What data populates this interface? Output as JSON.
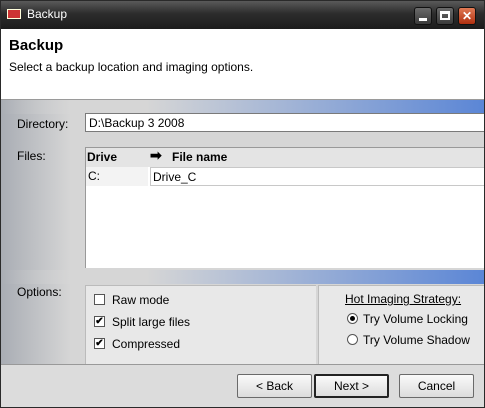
{
  "window": {
    "title": "Backup"
  },
  "header": {
    "title": "Backup",
    "subtitle": "Select a backup location and imaging options."
  },
  "directory": {
    "label": "Directory:",
    "value": "D:\\Backup 3 2008"
  },
  "files": {
    "label": "Files:",
    "columns": [
      "Drive",
      "File name"
    ],
    "rows": [
      {
        "drive": "C:",
        "file": "Drive_C"
      }
    ]
  },
  "options": {
    "label": "Options:",
    "items": [
      {
        "label": "Raw mode",
        "checked": false
      },
      {
        "label": "Split large files",
        "checked": true
      },
      {
        "label": "Compressed",
        "checked": true
      }
    ]
  },
  "hot_imaging": {
    "title": "Hot Imaging Strategy:",
    "choices": [
      {
        "label": "Try Volume Locking",
        "selected": true
      },
      {
        "label": "Try Volume Shadow",
        "selected": false
      }
    ]
  },
  "footer": {
    "back": "< Back",
    "next": "Next >",
    "cancel": "Cancel"
  },
  "icons": {
    "check": "✔",
    "arrow": "➡",
    "close": "✕"
  }
}
